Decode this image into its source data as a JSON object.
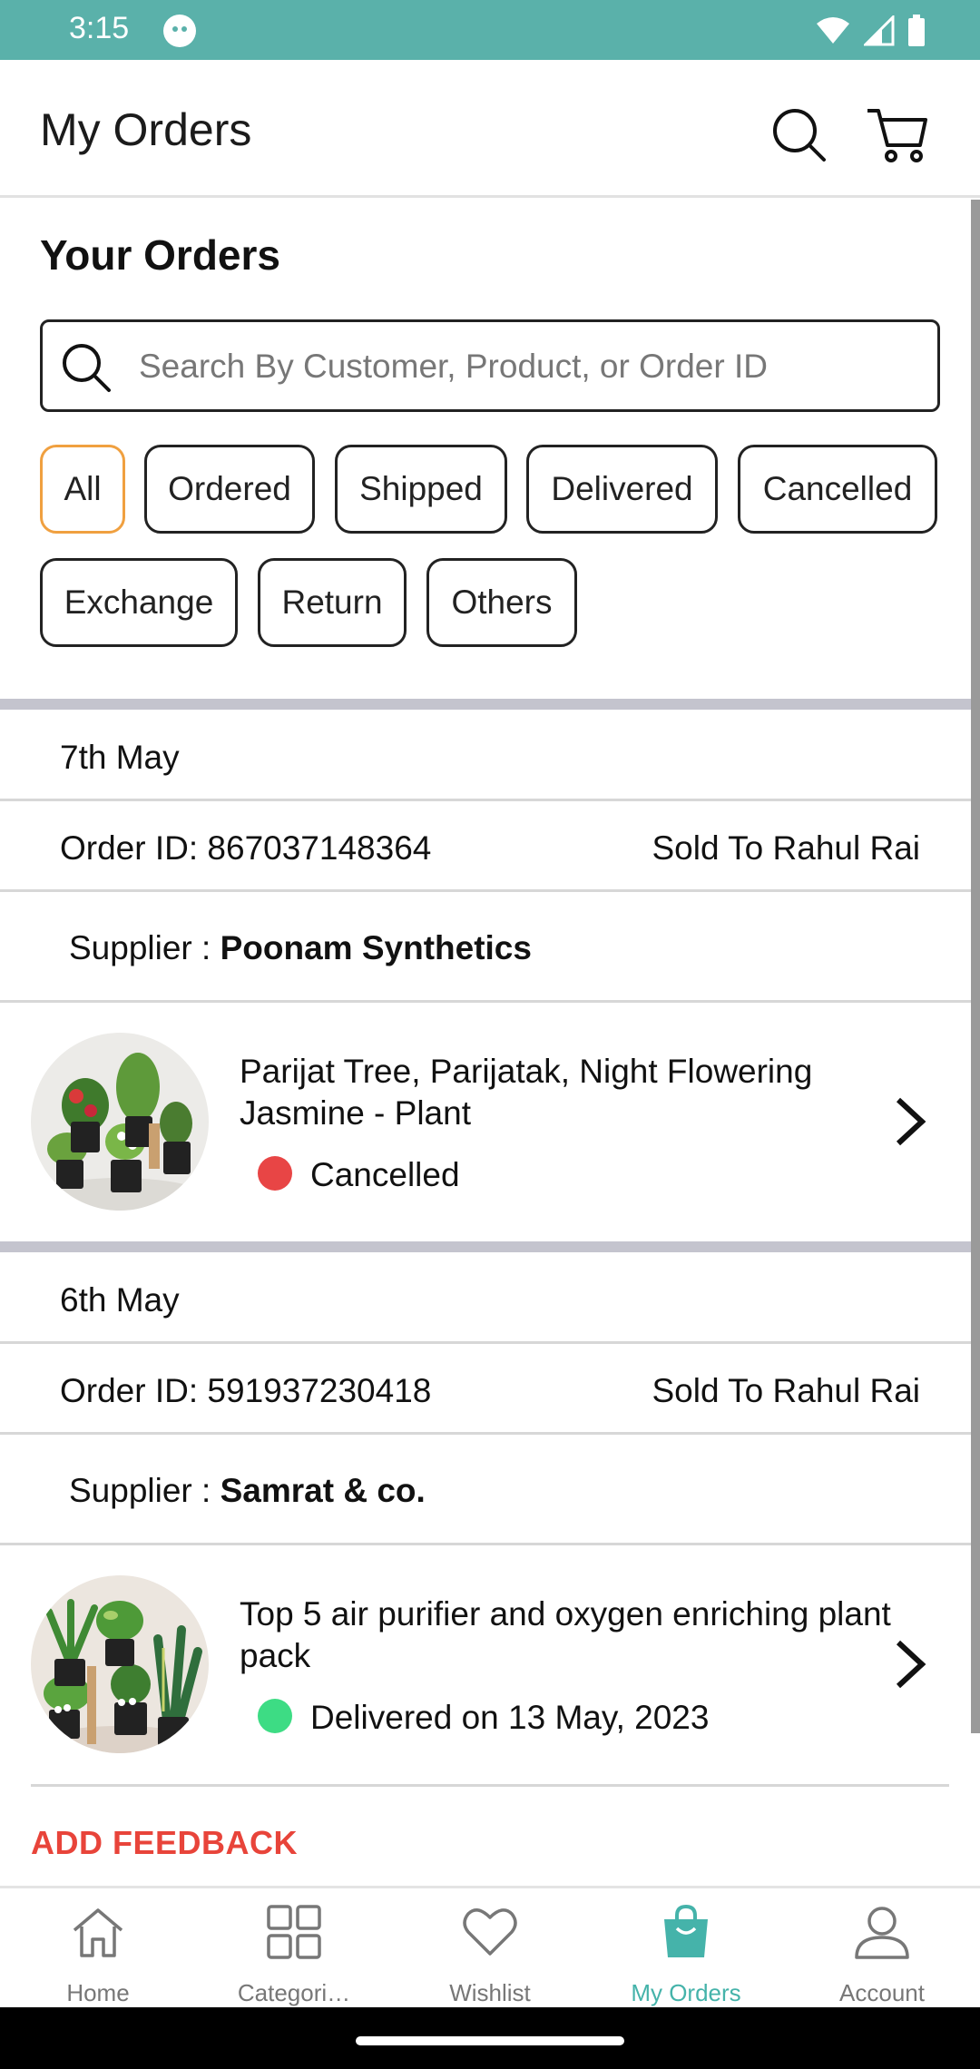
{
  "status_bar": {
    "time": "3:15"
  },
  "app_bar": {
    "title": "My Orders"
  },
  "orders_section": {
    "title": "Your Orders",
    "search_placeholder": "Search By Customer, Product, or Order ID",
    "filters": [
      "All",
      "Ordered",
      "Shipped",
      "Delivered",
      "Cancelled",
      "Exchange",
      "Return",
      "Others"
    ],
    "active_filter": "All"
  },
  "orders": [
    {
      "date": "7th May",
      "order_id": "Order ID: 867037148364",
      "sold_to": "Sold To Rahul Rai",
      "supplier_label": "Supplier : ",
      "supplier_name": "Poonam Synthetics",
      "product_name": "Parijat Tree, Parijatak, Night Flowering Jasmine - Plant",
      "status": "Cancelled",
      "status_color": "#e84545"
    },
    {
      "date": "6th May",
      "order_id": "Order ID: 591937230418",
      "sold_to": "Sold To Rahul Rai",
      "supplier_label": "Supplier : ",
      "supplier_name": "Samrat & co.",
      "product_name": "Top 5 air purifier and oxygen enriching plant pack",
      "status": "Delivered on 13 May, 2023",
      "status_color": "#3ddc84",
      "feedback_label": "ADD FEEDBACK"
    }
  ],
  "bottom_nav": {
    "items": [
      {
        "label": "Home",
        "icon": "home-icon"
      },
      {
        "label": "Categori…",
        "icon": "categories-icon"
      },
      {
        "label": "Wishlist",
        "icon": "heart-icon"
      },
      {
        "label": "My Orders",
        "icon": "shopping-bag-icon"
      },
      {
        "label": "Account",
        "icon": "person-icon"
      }
    ],
    "active": "My Orders"
  },
  "colors": {
    "status_bar": "#5ab1aa",
    "accent": "#45b3aa",
    "active_chip_border": "#f0a040",
    "feedback": "#e8443a"
  }
}
